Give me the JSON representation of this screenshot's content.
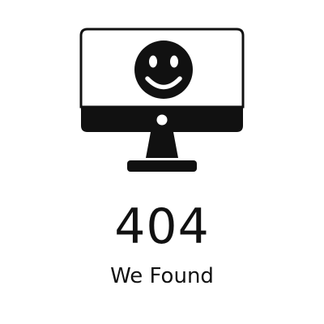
{
  "error_code": "404",
  "message": "We Found",
  "illustration": {
    "icon": "monitor-smiley-icon",
    "ink_color": "#111111",
    "screen_color": "#ffffff"
  }
}
